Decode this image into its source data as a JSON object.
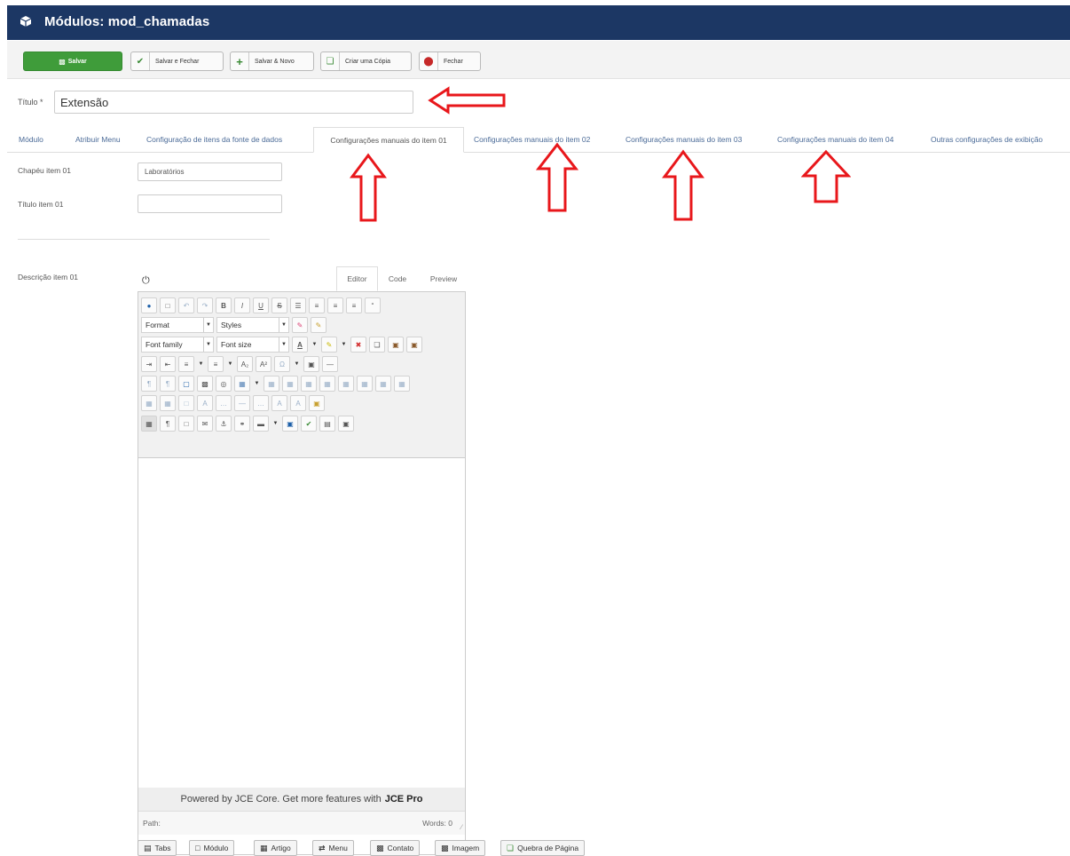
{
  "header": {
    "title": "Módulos: mod_chamadas",
    "bg_color": "#1c3764",
    "icon": "cube-icon"
  },
  "toolbar": {
    "save": "Salvar",
    "save_close": "Salvar e Fechar",
    "save_new": "Salvar & Novo",
    "save_copy": "Criar uma Cópia",
    "close": "Fechar"
  },
  "title_field": {
    "label": "Título *",
    "value": "Extensão"
  },
  "tabs": [
    "Módulo",
    "Atribuir Menu",
    "Configuração de itens da fonte de dados",
    "Configurações manuais do item 01",
    "Configurações manuais do item 02",
    "Configurações manuais do item 03",
    "Configurações manuais do item 04",
    "Outras configurações de exibição"
  ],
  "active_tab": "Configurações manuais do item 01",
  "fields": {
    "chapeu_label": "Chapéu item 01",
    "chapeu_value": "Laboratórios",
    "titulo_label": "Título item 01",
    "titulo_value": "",
    "descricao_label": "Descrição item 01"
  },
  "editor": {
    "tabs": [
      "Editor",
      "Code",
      "Preview"
    ],
    "format": "Format",
    "styles": "Styles",
    "font_family": "Font family",
    "font_size": "Font size",
    "powered_text": "Powered by JCE Core. Get more features with",
    "powered_bold": "JCE Pro",
    "path_label": "Path:",
    "words": "Words: 0"
  },
  "bottom_buttons": [
    "Tabs",
    "Módulo",
    "Artigo",
    "Menu",
    "Contato",
    "Imagem",
    "Quebra de Página"
  ],
  "annotations": {
    "arrow_color": "#e8171b"
  }
}
